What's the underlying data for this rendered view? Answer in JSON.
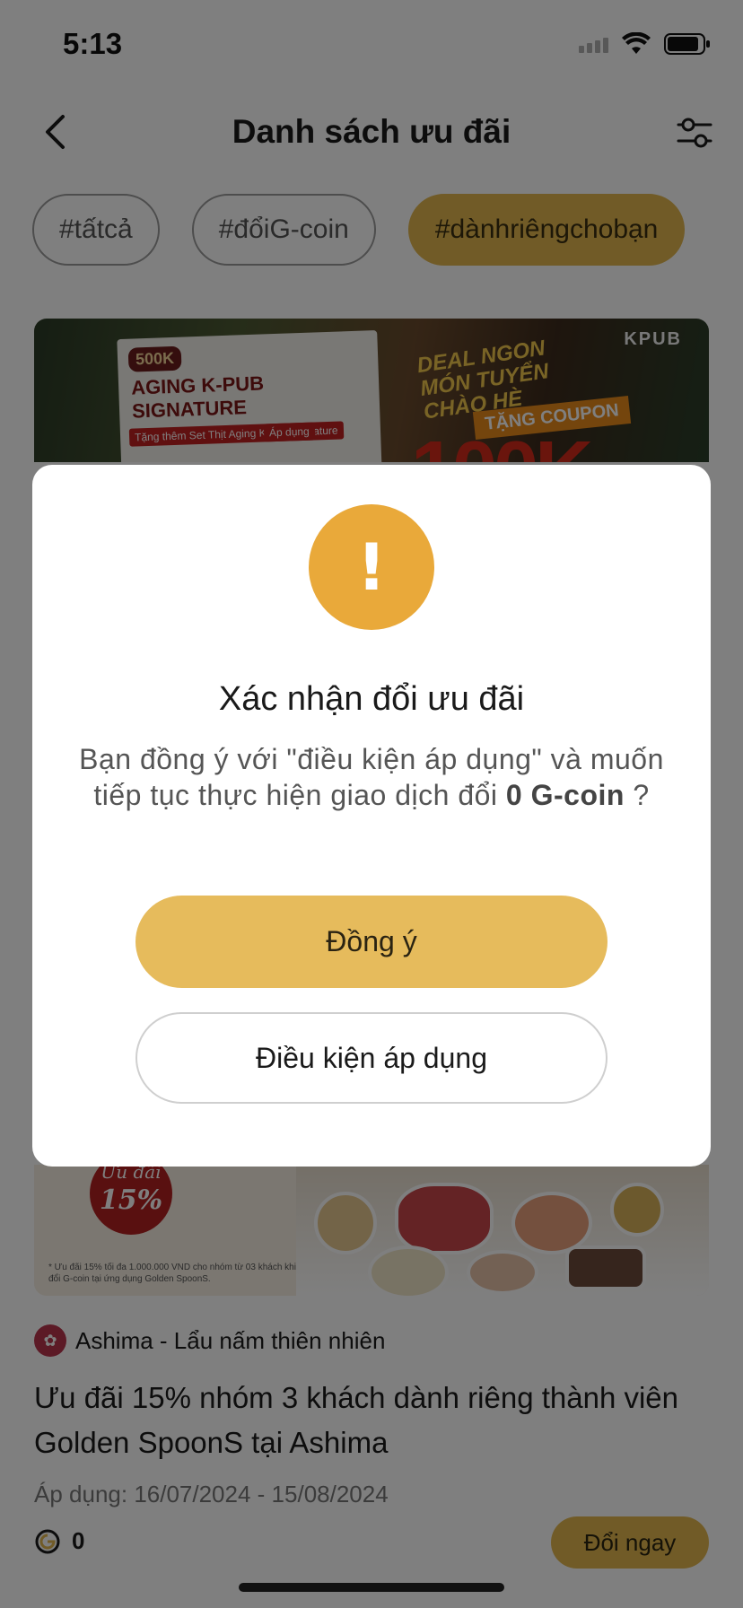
{
  "status_bar": {
    "time": "5:13"
  },
  "header": {
    "title": "Danh sách ưu đãi"
  },
  "tags": [
    {
      "label": "#tấtcả",
      "active": false
    },
    {
      "label": "#đổiG-coin",
      "active": false
    },
    {
      "label": "#dànhriêngchobạn",
      "active": true
    }
  ],
  "banner_top": {
    "poster_badge": "500K",
    "poster_title": "AGING K-PUB SIGNATURE",
    "poster_chip_left": "Tặng thêm Set Thịt Aging K-Pub Signature",
    "poster_chip_right": "Áp dụng",
    "deal_text_1": "DEAL NGON",
    "deal_text_2": "MÓN TUYỂN",
    "deal_text_3": "CHÀO HÈ",
    "coupon": "TẶNG COUPON",
    "big_number": "100K",
    "brand": "KPUB"
  },
  "banner_bottom": {
    "uudai_label": "Ưu đãi",
    "uudai_percent": "15%",
    "note": "* Ưu đãi 15% tối đa 1.000.000 VND cho nhóm từ 03 khách khi đổi G-coin tại ứng dụng Golden SpoonS."
  },
  "card": {
    "restaurant": "Ashima - Lẩu nấm thiên nhiên",
    "title": "Ưu đãi 15% nhóm 3 khách dành riêng thành viên Golden SpoonS tại Ashima",
    "dates": "Áp dụng: 16/07/2024 - 15/08/2024",
    "coin_value": "0",
    "redeem_label": "Đổi ngay"
  },
  "modal": {
    "icon": "!",
    "title": "Xác nhận đổi ưu đãi",
    "message_prefix": "Bạn đồng ý với \"điều kiện áp dụng\" và muốn tiếp tục thực hiện giao dịch đổi ",
    "message_amount": "0  G-coin",
    "message_suffix": " ?",
    "confirm_label": "Đồng ý",
    "terms_label": "Điều kiện áp dụng"
  },
  "colors": {
    "accent": "#e2b74f",
    "warning": "#e9a93a",
    "overlay": "rgba(0,0,0,0.5)"
  }
}
